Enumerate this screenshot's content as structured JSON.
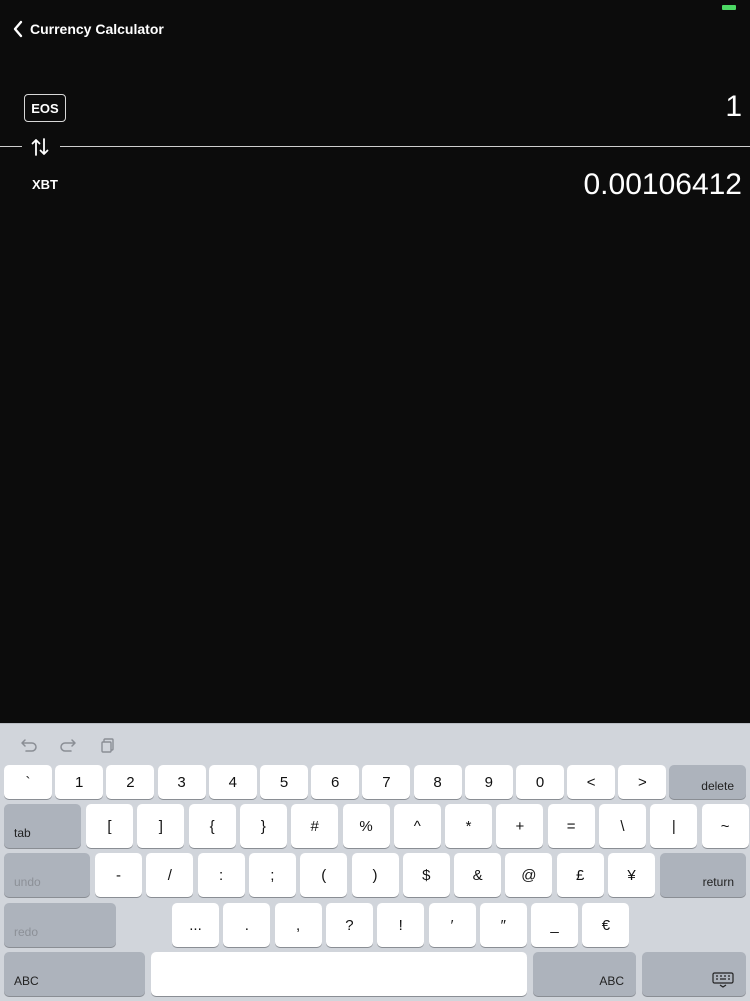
{
  "nav": {
    "title": "Currency Calculator"
  },
  "converter": {
    "from_currency": "EOS",
    "from_value": "1",
    "to_currency": "XBT",
    "to_value": "0.00106412"
  },
  "keyboard": {
    "row1": [
      "`",
      "1",
      "2",
      "3",
      "4",
      "5",
      "6",
      "7",
      "8",
      "9",
      "0",
      "<",
      ">"
    ],
    "delete_label": "delete",
    "tab_label": "tab",
    "row2": [
      "[",
      "]",
      "{",
      "}",
      "#",
      "%",
      "^",
      "*",
      "+",
      "=",
      "\\",
      "|",
      "~"
    ],
    "undo_label": "undo",
    "row3": [
      "-",
      "/",
      ":",
      ";",
      "(",
      ")",
      "$",
      "&",
      "@",
      "£",
      "¥"
    ],
    "return_label": "return",
    "redo_label": "redo",
    "row4": [
      "...",
      ".",
      ",",
      "?",
      "!",
      "′",
      "″",
      "_",
      "€"
    ],
    "abc_left_label": "ABC",
    "abc_right_label": "ABC",
    "toolbar_icons": [
      "undo-arrow-icon",
      "redo-arrow-icon",
      "paste-icon"
    ],
    "dismiss_icon": "keyboard-dismiss-icon"
  },
  "colors": {
    "background": "#0c0c0c",
    "battery": "#4cd964",
    "keyboard_bg": "#d1d5db"
  }
}
